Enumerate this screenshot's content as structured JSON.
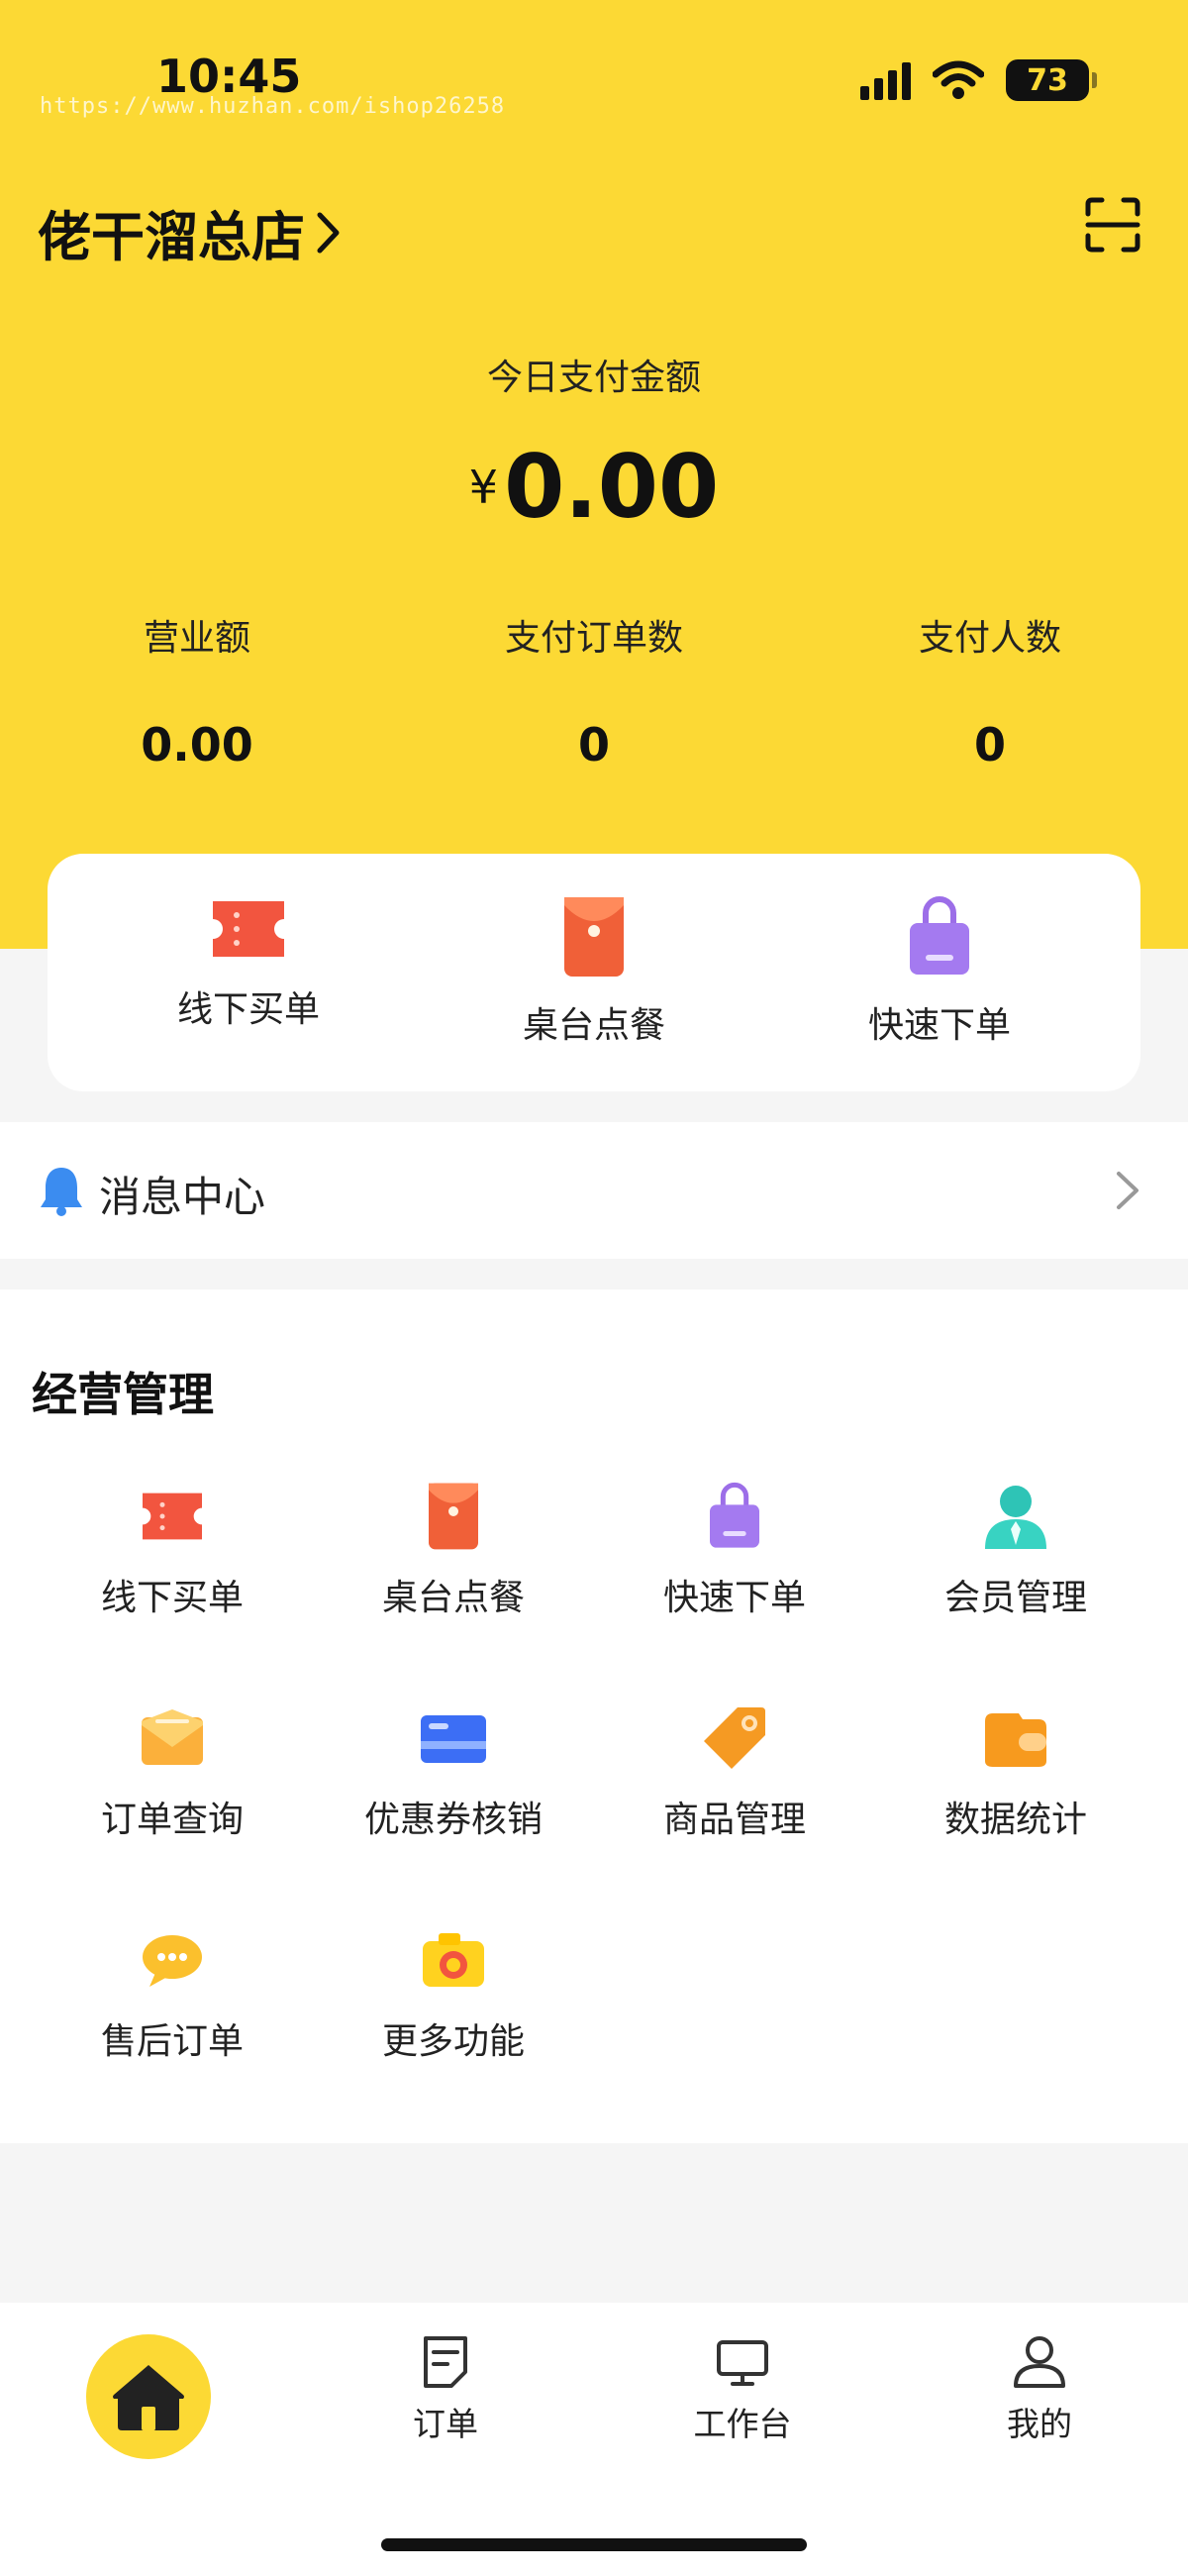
{
  "status_bar": {
    "time": "10:45",
    "battery": "73"
  },
  "watermark": "https://www.huzhan.com/ishop26258",
  "header": {
    "store_name": "佬干溜总店",
    "scan_icon": "scan-icon"
  },
  "today": {
    "label": "今日支付金额",
    "currency": "¥",
    "amount": "0.00"
  },
  "stats": [
    {
      "label": "营业额",
      "value": "0.00"
    },
    {
      "label": "支付订单数",
      "value": "0"
    },
    {
      "label": "支付人数",
      "value": "0"
    }
  ],
  "quick_actions": [
    {
      "label": "线下买单",
      "icon": "ticket-icon"
    },
    {
      "label": "桌台点餐",
      "icon": "red-envelope-icon"
    },
    {
      "label": "快速下单",
      "icon": "shopping-bag-icon"
    }
  ],
  "message_center": {
    "label": "消息中心",
    "icon": "bell-icon"
  },
  "management": {
    "title": "经营管理",
    "items": [
      {
        "label": "线下买单",
        "icon": "ticket-icon"
      },
      {
        "label": "桌台点餐",
        "icon": "red-envelope-icon"
      },
      {
        "label": "快速下单",
        "icon": "shopping-bag-icon"
      },
      {
        "label": "会员管理",
        "icon": "member-icon"
      },
      {
        "label": "订单查询",
        "icon": "envelope-icon"
      },
      {
        "label": "优惠券核销",
        "icon": "card-icon"
      },
      {
        "label": "商品管理",
        "icon": "tag-icon"
      },
      {
        "label": "数据统计",
        "icon": "wallet-icon"
      },
      {
        "label": "售后订单",
        "icon": "chat-icon"
      },
      {
        "label": "更多功能",
        "icon": "camera-icon"
      }
    ]
  },
  "tabbar": {
    "items": [
      {
        "label": "",
        "icon": "home-icon"
      },
      {
        "label": "订单",
        "icon": "order-icon"
      },
      {
        "label": "工作台",
        "icon": "monitor-icon"
      },
      {
        "label": "我的",
        "icon": "user-icon"
      }
    ]
  },
  "colors": {
    "brand_yellow": "#fcd934",
    "ticket_red": "#f2553f",
    "bag_purple": "#9c6ee8",
    "member_teal": "#2ec4b6",
    "bell_blue": "#3b8cf0"
  }
}
